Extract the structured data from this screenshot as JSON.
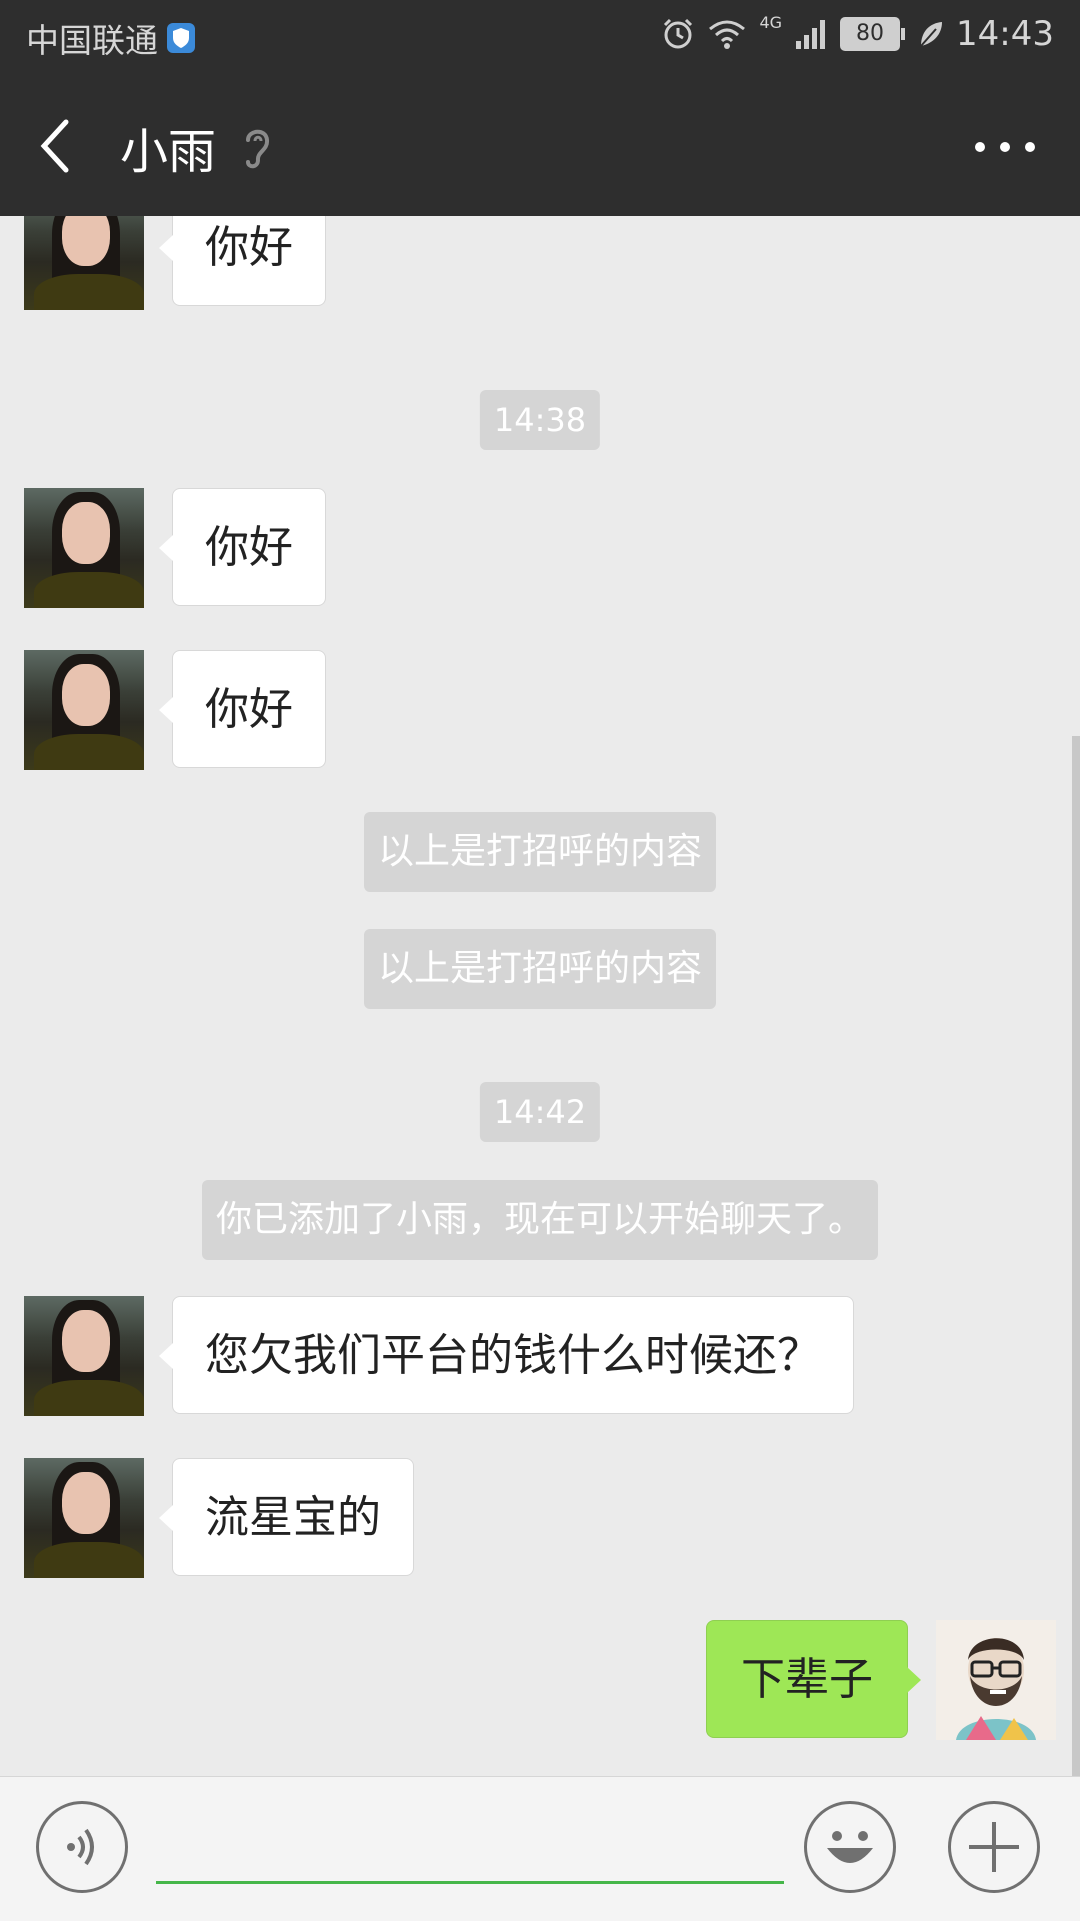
{
  "status_bar": {
    "carrier": "中国联通",
    "battery": "80",
    "network": "4G",
    "time": "14:43"
  },
  "header": {
    "title": "小雨"
  },
  "messages": {
    "m1": "你好",
    "time1": "14:38",
    "m2": "你好",
    "m3": "你好",
    "sys1": "以上是打招呼的内容",
    "sys2": "以上是打招呼的内容",
    "time2": "14:42",
    "sys3": "你已添加了小雨，现在可以开始聊天了。",
    "m4": "您欠我们平台的钱什么时候还？",
    "m5": "流星宝的",
    "m6": "下辈子"
  },
  "colors": {
    "header_bg": "#2e2e2e",
    "chat_bg": "#ebebeb",
    "sent_bubble": "#9ee756",
    "received_bubble": "#ffffff",
    "input_underline": "#45b649"
  },
  "icons": {
    "back": "chevron-left-icon",
    "voice_mode": "ear-icon",
    "more": "more-dots-icon",
    "voice": "voice-icon",
    "emoji": "emoji-icon",
    "add": "plus-icon"
  }
}
